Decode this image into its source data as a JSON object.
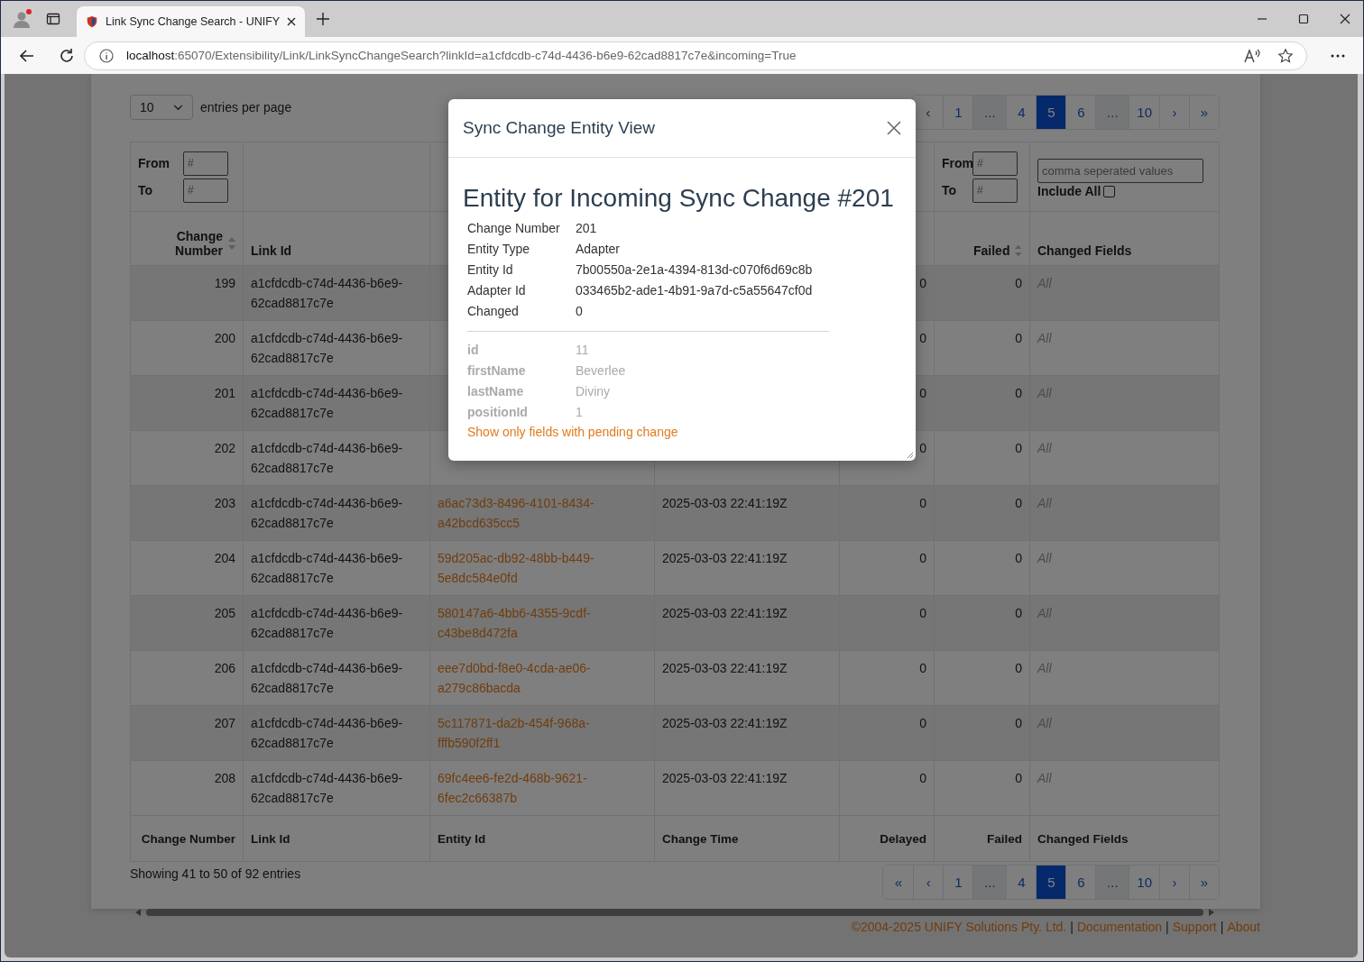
{
  "browser": {
    "tab_title": "Link Sync Change Search - UNIFY",
    "url_host": "localhost",
    "url_rest": ":65070/Extensibility/Link/LinkSyncChangeSearch?linkId=a1cfdcdb-c74d-4436-b6e9-62cad8817c7e&incoming=True"
  },
  "page_size": {
    "value": "10",
    "label": "entries per page"
  },
  "top_pagination": [
    {
      "kind": "prev",
      "label": "‹",
      "selected": false
    },
    {
      "kind": "page",
      "label": "1",
      "selected": false
    },
    {
      "kind": "ellipsis",
      "label": "...",
      "selected": false
    },
    {
      "kind": "page",
      "label": "4",
      "selected": false
    },
    {
      "kind": "page",
      "label": "5",
      "selected": true
    },
    {
      "kind": "page",
      "label": "6",
      "selected": false
    },
    {
      "kind": "ellipsis",
      "label": "...",
      "selected": false
    },
    {
      "kind": "page",
      "label": "10",
      "selected": false
    },
    {
      "kind": "next",
      "label": "›",
      "selected": false
    },
    {
      "kind": "last",
      "label": "»",
      "selected": false
    }
  ],
  "filters": {
    "change_number": {
      "from_label": "From",
      "from_placeholder": "#",
      "to_label": "To",
      "to_placeholder": "#"
    },
    "failed": {
      "from_label": "From",
      "from_placeholder": "#",
      "to_label": "To",
      "to_placeholder": "#"
    },
    "changed_fields": {
      "placeholder": "comma seperated values",
      "include_all_label": "Include All",
      "include_all_checked": false
    }
  },
  "columns": [
    {
      "label": "Change Number",
      "sortable": true
    },
    {
      "label": "Link Id",
      "sortable": false
    },
    {},
    {},
    {},
    {
      "label": "Failed",
      "sortable": true
    },
    {
      "label": "Changed Fields",
      "sortable": false
    }
  ],
  "rows": [
    {
      "change_number": "199",
      "link_id": "a1cfdcdb-c74d-4436-b6e9-62cad8817c7e",
      "delayed": "0",
      "failed": "0",
      "changed_fields": "All"
    },
    {
      "change_number": "200",
      "link_id": "a1cfdcdb-c74d-4436-b6e9-62cad8817c7e",
      "delayed": "0",
      "failed": "0",
      "changed_fields": "All"
    },
    {
      "change_number": "201",
      "link_id": "a1cfdcdb-c74d-4436-b6e9-62cad8817c7e",
      "delayed": "0",
      "failed": "0",
      "changed_fields": "All"
    },
    {
      "change_number": "202",
      "link_id": "a1cfdcdb-c74d-4436-b6e9-62cad8817c7e",
      "delayed": "0",
      "failed": "0",
      "changed_fields": "All"
    },
    {
      "change_number": "203",
      "link_id": "a1cfdcdb-c74d-4436-b6e9-62cad8817c7e",
      "entity_id": "a6ac73d3-8496-4101-8434-a42bcd635cc5",
      "change_time": "2025-03-03 22:41:19Z",
      "delayed": "0",
      "failed": "0",
      "changed_fields": "All"
    },
    {
      "change_number": "204",
      "link_id": "a1cfdcdb-c74d-4436-b6e9-62cad8817c7e",
      "entity_id": "59d205ac-db92-48bb-b449-5e8dc584e0fd",
      "change_time": "2025-03-03 22:41:19Z",
      "delayed": "0",
      "failed": "0",
      "changed_fields": "All"
    },
    {
      "change_number": "205",
      "link_id": "a1cfdcdb-c74d-4436-b6e9-62cad8817c7e",
      "entity_id": "580147a6-4bb6-4355-9cdf-c43be8d472fa",
      "change_time": "2025-03-03 22:41:19Z",
      "delayed": "0",
      "failed": "0",
      "changed_fields": "All"
    },
    {
      "change_number": "206",
      "link_id": "a1cfdcdb-c74d-4436-b6e9-62cad8817c7e",
      "entity_id": "eee7d0bd-f8e0-4cda-ae06-a279c86bacda",
      "change_time": "2025-03-03 22:41:19Z",
      "delayed": "0",
      "failed": "0",
      "changed_fields": "All"
    },
    {
      "change_number": "207",
      "link_id": "a1cfdcdb-c74d-4436-b6e9-62cad8817c7e",
      "entity_id": "5c117871-da2b-454f-968a-fffb590f2ff1",
      "change_time": "2025-03-03 22:41:19Z",
      "delayed": "0",
      "failed": "0",
      "changed_fields": "All"
    },
    {
      "change_number": "208",
      "link_id": "a1cfdcdb-c74d-4436-b6e9-62cad8817c7e",
      "entity_id": "69fc4ee6-fe2d-468b-9621-6fec2c66387b",
      "change_time": "2025-03-03 22:41:19Z",
      "delayed": "0",
      "failed": "0",
      "changed_fields": "All"
    }
  ],
  "footer_columns": [
    "Change Number",
    "Link Id",
    "Entity Id",
    "Change Time",
    "Delayed",
    "Failed",
    "Changed Fields"
  ],
  "summary": "Showing 41 to 50 of 92 entries",
  "bottom_pagination": [
    {
      "kind": "first",
      "label": "«",
      "selected": false
    },
    {
      "kind": "prev",
      "label": "‹",
      "selected": false
    },
    {
      "kind": "page",
      "label": "1",
      "selected": false
    },
    {
      "kind": "ellipsis",
      "label": "...",
      "selected": false
    },
    {
      "kind": "page",
      "label": "4",
      "selected": false
    },
    {
      "kind": "page",
      "label": "5",
      "selected": true
    },
    {
      "kind": "page",
      "label": "6",
      "selected": false
    },
    {
      "kind": "ellipsis",
      "label": "...",
      "selected": false
    },
    {
      "kind": "page",
      "label": "10",
      "selected": false
    },
    {
      "kind": "next",
      "label": "›",
      "selected": false
    },
    {
      "kind": "last",
      "label": "»",
      "selected": false
    }
  ],
  "footer": {
    "separator": "|",
    "links": [
      "©2004-2025 UNIFY Solutions Pty. Ltd.",
      "Documentation",
      "Support",
      "About"
    ]
  },
  "modal": {
    "title": "Sync Change Entity View",
    "heading": "Entity for Incoming Sync Change #201",
    "properties": [
      {
        "label": "Change Number",
        "value": "201"
      },
      {
        "label": "Entity Type",
        "value": "Adapter"
      },
      {
        "label": "Entity Id",
        "value": "7b00550a-2e1a-4394-813d-c070f6d69c8b"
      },
      {
        "label": "Adapter Id",
        "value": "033465b2-ade1-4b91-9a7d-c5a55647cf0d"
      },
      {
        "label": "Changed",
        "value": "0"
      }
    ],
    "fields": [
      {
        "name": "id",
        "value": "11",
        "pending": false
      },
      {
        "name": "firstName",
        "value": "Beverlee",
        "pending": false
      },
      {
        "name": "lastName",
        "value": "Diviny",
        "pending": false
      },
      {
        "name": "positionId",
        "value": "1",
        "pending": false
      }
    ],
    "link": "Show only fields with pending change"
  }
}
